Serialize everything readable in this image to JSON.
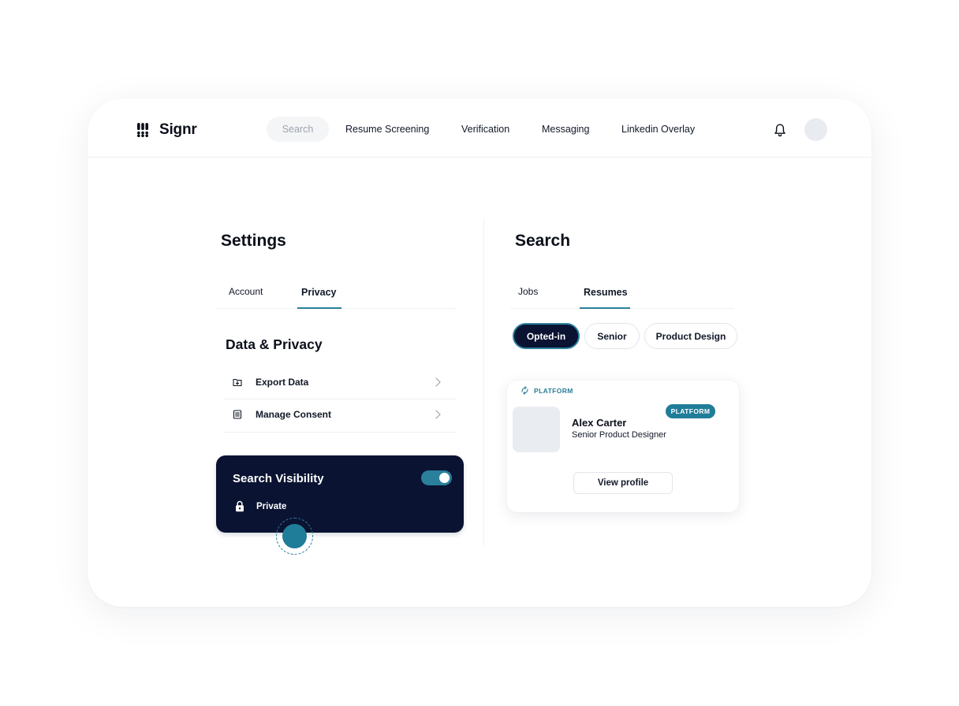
{
  "app": {
    "brand": "Signr",
    "nav": {
      "search_label": "Search",
      "items": [
        "Resume Screening",
        "Verification",
        "Messaging",
        "Linkedin Overlay"
      ]
    },
    "icons": {
      "logo": "signr-logo-icon",
      "notifications": "bell-icon",
      "user": "avatar"
    }
  },
  "settings": {
    "title": "Settings",
    "tabs": [
      {
        "label": "Account",
        "active": false
      },
      {
        "label": "Privacy",
        "active": true
      }
    ],
    "section_title": "Data & Privacy",
    "rows": [
      {
        "label": "Export Data",
        "icon": "export-data-icon"
      },
      {
        "label": "Manage Consent",
        "icon": "manage-consent-icon"
      }
    ],
    "visibility": {
      "title": "Search Visibility",
      "toggle_on": true,
      "status_icon": "lock-icon",
      "status": "Private"
    }
  },
  "search": {
    "title": "Search",
    "tabs": [
      {
        "label": "Jobs",
        "active": false
      },
      {
        "label": "Resumes",
        "active": true
      }
    ],
    "filters": [
      {
        "label": "Opted-in",
        "active": true
      },
      {
        "label": "Senior",
        "active": false
      },
      {
        "label": "Product Design",
        "active": false
      }
    ],
    "result": {
      "source": "PLATFORM",
      "badge": "PLATFORM",
      "name": "Alex Carter",
      "role": "Senior Product Designer",
      "action": "View profile"
    }
  },
  "colors": {
    "accent": "#2a7f9b",
    "dark_navy": "#0a1332",
    "text": "#0b0f1a",
    "muted": "#9ca3af",
    "border": "#e2e5ea"
  }
}
